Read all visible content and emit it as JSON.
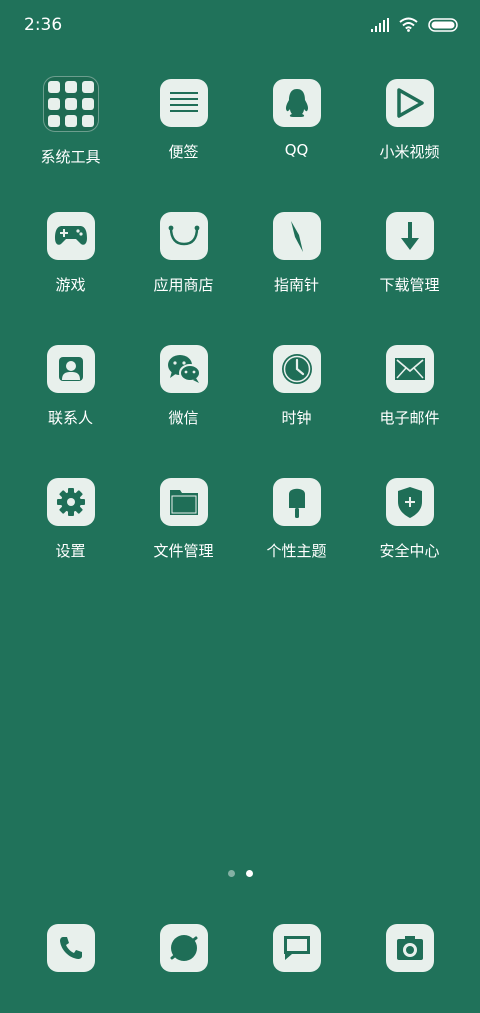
{
  "status_bar": {
    "time": "2:36",
    "icons": [
      "signal-icon",
      "wifi-icon",
      "battery-icon"
    ]
  },
  "colors": {
    "background": "#20725A",
    "icon_tile": "#E8F0EC",
    "glyph": "#1F6E57"
  },
  "apps": [
    {
      "label": "系统工具",
      "icon": "folder-icon"
    },
    {
      "label": "便签",
      "icon": "notes-icon"
    },
    {
      "label": "QQ",
      "icon": "qq-penguin-icon"
    },
    {
      "label": "小米视频",
      "icon": "play-icon"
    },
    {
      "label": "游戏",
      "icon": "gamepad-icon"
    },
    {
      "label": "应用商店",
      "icon": "store-bag-icon"
    },
    {
      "label": "指南针",
      "icon": "compass-icon"
    },
    {
      "label": "下载管理",
      "icon": "download-arrow-icon"
    },
    {
      "label": "联系人",
      "icon": "contact-person-icon"
    },
    {
      "label": "微信",
      "icon": "wechat-icon"
    },
    {
      "label": "时钟",
      "icon": "clock-icon"
    },
    {
      "label": "电子邮件",
      "icon": "mail-envelope-icon"
    },
    {
      "label": "设置",
      "icon": "gear-icon"
    },
    {
      "label": "文件管理",
      "icon": "file-folder-icon"
    },
    {
      "label": "个性主题",
      "icon": "popsicle-icon"
    },
    {
      "label": "安全中心",
      "icon": "shield-plus-icon"
    }
  ],
  "pagination": {
    "pages": 2,
    "current": 2
  },
  "dock": [
    {
      "icon": "phone-icon"
    },
    {
      "icon": "browser-circle-icon"
    },
    {
      "icon": "message-bubble-icon"
    },
    {
      "icon": "camera-icon"
    }
  ]
}
